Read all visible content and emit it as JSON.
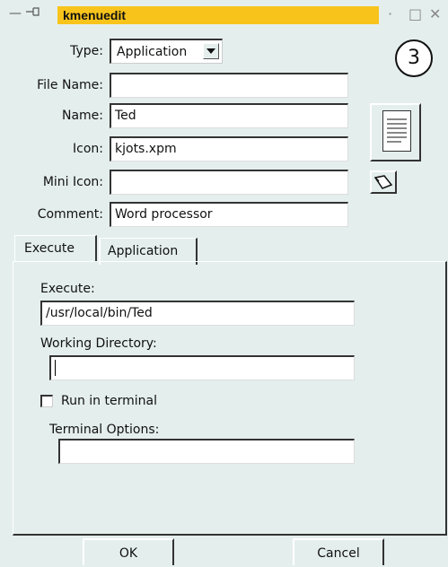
{
  "window": {
    "title": "kmenuedit",
    "minimize_glyph": "·",
    "maximize_glyph": "□",
    "close_glyph": "✕"
  },
  "badge": "3",
  "form": {
    "type_label": "Type:",
    "type_value": "Application",
    "file_name_label": "File Name:",
    "file_name_value": "",
    "name_label": "Name:",
    "name_value": "Ted",
    "icon_label": "Icon:",
    "icon_value": "kjots.xpm",
    "mini_icon_label": "Mini Icon:",
    "mini_icon_value": "",
    "comment_label": "Comment:",
    "comment_value": "Word processor"
  },
  "tabs": [
    {
      "label": "Execute",
      "active": true
    },
    {
      "label": "Application",
      "active": false
    }
  ],
  "execute": {
    "execute_label": "Execute:",
    "execute_value": "/usr/local/bin/Ted",
    "workdir_label": "Working Directory:",
    "workdir_value": "",
    "run_in_terminal_label": "Run in terminal",
    "run_in_terminal_checked": false,
    "terminal_options_label": "Terminal Options:",
    "terminal_options_value": ""
  },
  "buttons": {
    "ok": "OK",
    "cancel": "Cancel"
  },
  "icons": {
    "window_menu": "dash-icon",
    "sticky": "pin-icon",
    "icon_preview": "document-icon",
    "mini_icon": "wand-icon"
  },
  "colors": {
    "background": "#e4eeed",
    "title_active": "#f8c41c"
  }
}
